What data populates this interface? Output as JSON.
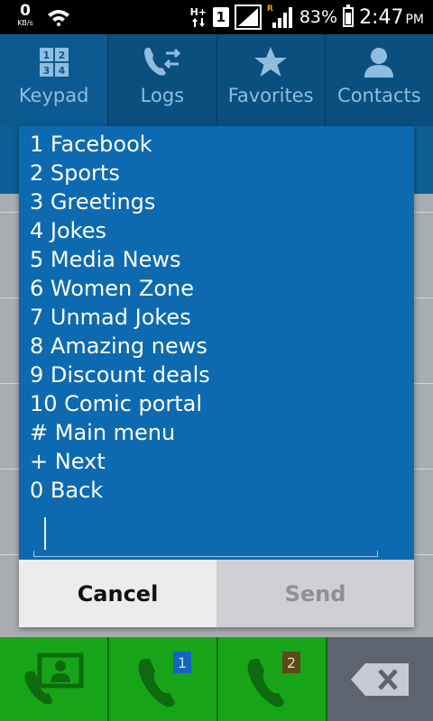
{
  "status_bar": {
    "speed_value": "0",
    "speed_unit": "KB/s",
    "network_type": "H+",
    "sim_slot": "1",
    "roaming_indicator": "R",
    "battery_percent": "83%",
    "battery_level": 0.83,
    "time": "2:47",
    "time_suffix": "PM"
  },
  "tabs": [
    {
      "label": "Keypad",
      "icon": "keypad-icon"
    },
    {
      "label": "Logs",
      "icon": "logs-icon"
    },
    {
      "label": "Favorites",
      "icon": "star-icon"
    },
    {
      "label": "Contacts",
      "icon": "contact-icon"
    }
  ],
  "dialog": {
    "menu_items": [
      "1 Facebook",
      "2 Sports",
      "3 Greetings",
      "4 Jokes",
      "5 Media News",
      "6 Women Zone",
      "7 Unmad Jokes",
      "8 Amazing news",
      "9 Discount deals",
      "10 Comic portal",
      "# Main menu",
      "+ Next",
      "0 Back"
    ],
    "reply_value": "",
    "cancel_label": "Cancel",
    "send_label": "Send"
  },
  "bottom_bar": {
    "sim1_badge": "1",
    "sim2_badge": "2"
  },
  "colors": {
    "dialog_bg": "#0d6ab1",
    "tab_bg": "#0a4f7e",
    "call_green": "#18a418",
    "delete_gray": "#5d6470"
  }
}
